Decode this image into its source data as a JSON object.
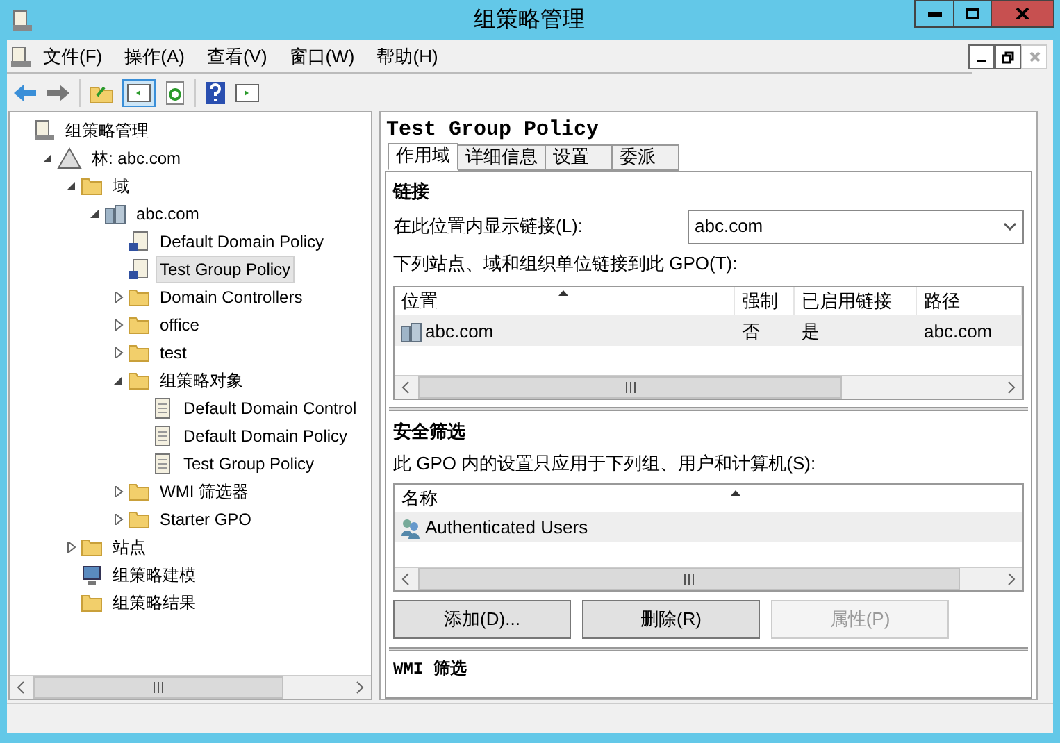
{
  "window": {
    "title": "组策略管理"
  },
  "menu": [
    "文件(F)",
    "操作(A)",
    "查看(V)",
    "窗口(W)",
    "帮助(H)"
  ],
  "tree": {
    "label": "组策略管理",
    "kind": "console",
    "selected": false,
    "children": [
      {
        "label": "林: abc.com",
        "kind": "forest",
        "expanded": true,
        "selected": false,
        "children": [
          {
            "label": "域",
            "kind": "domains",
            "expanded": true,
            "selected": false,
            "children": [
              {
                "label": "abc.com",
                "kind": "domain",
                "expanded": true,
                "selected": false,
                "children": [
                  {
                    "label": "Default Domain Policy",
                    "kind": "link",
                    "selected": false
                  },
                  {
                    "label": "Test Group Policy",
                    "kind": "link",
                    "selected": true
                  },
                  {
                    "label": "Domain Controllers",
                    "kind": "ou",
                    "expanded": false,
                    "selected": false
                  },
                  {
                    "label": "office",
                    "kind": "ou",
                    "expanded": false,
                    "selected": false
                  },
                  {
                    "label": "test",
                    "kind": "ou",
                    "expanded": false,
                    "selected": false
                  },
                  {
                    "label": "组策略对象",
                    "kind": "gpofolder",
                    "expanded": true,
                    "selected": false,
                    "children": [
                      {
                        "label": "Default Domain Control",
                        "kind": "gpo",
                        "selected": false
                      },
                      {
                        "label": "Default Domain Policy",
                        "kind": "gpo",
                        "selected": false
                      },
                      {
                        "label": "Test Group Policy",
                        "kind": "gpo",
                        "selected": false
                      }
                    ]
                  },
                  {
                    "label": "WMI 筛选器",
                    "kind": "wmi",
                    "expanded": false,
                    "selected": false
                  },
                  {
                    "label": "Starter GPO",
                    "kind": "starter",
                    "expanded": false,
                    "selected": false
                  }
                ]
              }
            ]
          },
          {
            "label": "站点",
            "kind": "sites",
            "expanded": false,
            "selected": false
          },
          {
            "label": "组策略建模",
            "kind": "modeling",
            "selected": false
          },
          {
            "label": "组策略结果",
            "kind": "results",
            "selected": false
          }
        ]
      }
    ]
  },
  "detail": {
    "title": "Test Group Policy",
    "tabs": [
      {
        "label": "作用域",
        "selected": true
      },
      {
        "label": "详细信息",
        "selected": false
      },
      {
        "label": "设置",
        "selected": false
      },
      {
        "label": "委派",
        "selected": false
      }
    ],
    "links": {
      "heading": "链接",
      "location_label": "在此位置内显示链接(L):",
      "location_value": "abc.com",
      "list_label": "下列站点、域和组织单位链接到此 GPO(T):",
      "columns": [
        "位置",
        "强制",
        "已启用链接",
        "路径"
      ],
      "rows": [
        [
          "abc.com",
          "否",
          "是",
          "abc.com"
        ]
      ]
    },
    "security": {
      "heading": "安全筛选",
      "label": "此 GPO 内的设置只应用于下列组、用户和计算机(S):",
      "columns": [
        "名称"
      ],
      "rows": [
        "Authenticated Users"
      ],
      "buttons": [
        {
          "label": "添加(D)...",
          "disabled": false
        },
        {
          "label": "删除(R)",
          "disabled": false
        },
        {
          "label": "属性(P)",
          "disabled": true
        }
      ]
    },
    "wmi": {
      "heading": "WMI 筛选"
    }
  }
}
